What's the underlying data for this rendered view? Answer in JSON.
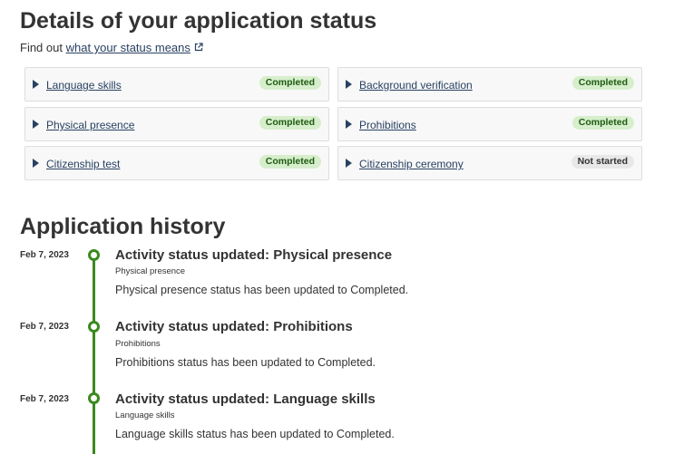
{
  "details": {
    "title": "Details of your application status",
    "find_out": "Find out",
    "status_link": "what your status means",
    "external_icon": "external-link-icon",
    "cards": [
      {
        "label": "Language skills",
        "status": "Completed"
      },
      {
        "label": "Background verification",
        "status": "Completed"
      },
      {
        "label": "Physical presence",
        "status": "Completed"
      },
      {
        "label": "Prohibitions",
        "status": "Completed"
      },
      {
        "label": "Citizenship test",
        "status": "Completed"
      },
      {
        "label": "Citizenship ceremony",
        "status": "Not started"
      }
    ]
  },
  "history": {
    "title": "Application history",
    "entries": [
      {
        "date": "Feb 7, 2023",
        "title": "Activity status updated: Physical presence",
        "subtitle": "Physical presence",
        "description": "Physical presence status has been updated to Completed."
      },
      {
        "date": "Feb 7, 2023",
        "title": "Activity status updated: Prohibitions",
        "subtitle": "Prohibitions",
        "description": "Prohibitions status has been updated to Completed."
      },
      {
        "date": "Feb 7, 2023",
        "title": "Activity status updated: Language skills",
        "subtitle": "Language skills",
        "description": "Language skills status has been updated to Completed."
      }
    ]
  },
  "colors": {
    "link": "#284162",
    "completed_bg": "#d6eecb",
    "completed_text": "#1e5b12",
    "not_started_bg": "#e8e8e8",
    "timeline": "#3a8a1e"
  }
}
